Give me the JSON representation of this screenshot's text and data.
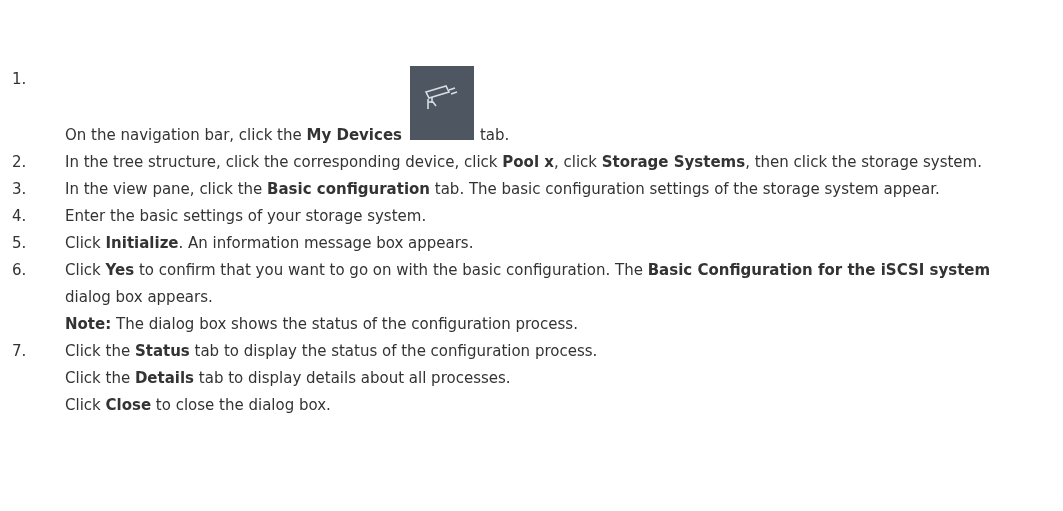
{
  "steps": [
    {
      "number": "1.",
      "paragraphs": [
        [
          {
            "kind": "text",
            "text": "On the navigation bar, click the **My Devices**"
          },
          {
            "kind": "icon"
          },
          {
            "kind": "text",
            "text": "tab."
          }
        ]
      ]
    },
    {
      "number": "2.",
      "paragraphs": [
        [
          {
            "kind": "text",
            "text": "In the tree structure, click the corresponding device, click **Pool x**, click **Storage Systems**, then click the storage system."
          }
        ]
      ]
    },
    {
      "number": "3.",
      "paragraphs": [
        [
          {
            "kind": "text",
            "text": "In the view pane, click the **Basic configuration** tab. The basic configuration settings of the storage system appear."
          }
        ]
      ]
    },
    {
      "number": "4.",
      "paragraphs": [
        [
          {
            "kind": "text",
            "text": "Enter the basic settings of your storage system."
          }
        ]
      ]
    },
    {
      "number": "5.",
      "paragraphs": [
        [
          {
            "kind": "text",
            "text": "Click **Initialize**. An information message box appears."
          }
        ]
      ]
    },
    {
      "number": "6.",
      "paragraphs": [
        [
          {
            "kind": "text",
            "text": "Click **Yes** to confirm that you want to go on with the basic configuration. The **Basic Configuration for the iSCSI system** dialog box appears."
          }
        ],
        [
          {
            "kind": "text",
            "text": "**Note:** The dialog box shows the status of the configuration process."
          }
        ]
      ]
    },
    {
      "number": "7.",
      "paragraphs": [
        [
          {
            "kind": "text",
            "text": "Click the **Status** tab to display the status of the configuration process."
          }
        ],
        [
          {
            "kind": "text",
            "text": "Click the **Details** tab to display details about all processes."
          }
        ],
        [
          {
            "kind": "text",
            "text": "Click **Close** to close the dialog box."
          }
        ]
      ]
    }
  ]
}
